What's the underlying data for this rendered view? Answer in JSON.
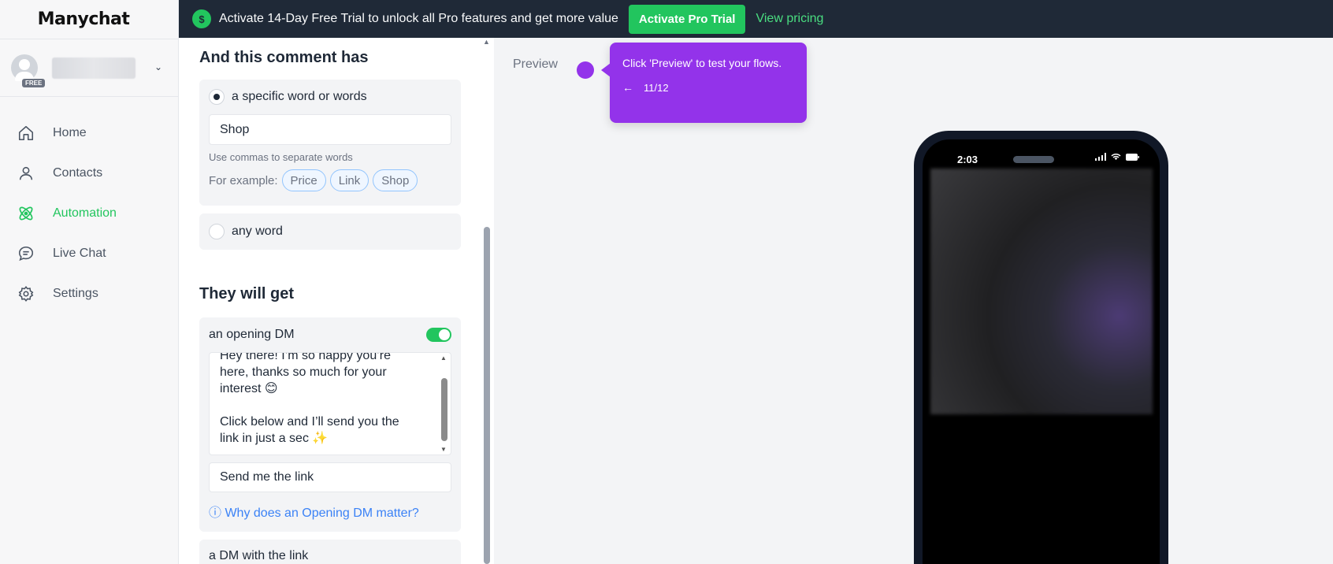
{
  "app": {
    "logo": "Manychat"
  },
  "account": {
    "badge": "FREE"
  },
  "sidebar": {
    "items": [
      {
        "label": "Home",
        "icon": "home-icon",
        "active": false
      },
      {
        "label": "Contacts",
        "icon": "user-icon",
        "active": false
      },
      {
        "label": "Automation",
        "icon": "automation-icon",
        "active": true
      },
      {
        "label": "Live Chat",
        "icon": "chat-icon",
        "active": false
      },
      {
        "label": "Settings",
        "icon": "gear-icon",
        "active": false
      }
    ]
  },
  "banner": {
    "icon": "dollar-icon",
    "text": "Activate 14-Day Free Trial to unlock all Pro features and get more value",
    "button": "Activate Pro Trial",
    "link": "View pricing"
  },
  "panel": {
    "comment_title": "And this comment has",
    "option_specific": "a specific word or words",
    "keyword_value": "Shop",
    "hint": "Use commas to separate words",
    "example_label": "For example:",
    "example_chips": [
      "Price",
      "Link",
      "Shop"
    ],
    "option_any": "any word",
    "get_title": "They will get",
    "opening_dm_label": "an opening DM",
    "opening_dm_enabled": true,
    "opening_dm_text": "Hey there! I’m so happy you’re here, thanks so much for your interest 😊\n\nClick below and I’ll send you the link in just a sec ✨",
    "button_text": "Send me the link",
    "info_link": "Why does an Opening DM matter?",
    "dm_link_label": "a DM with the link"
  },
  "preview": {
    "label": "Preview",
    "tooltip_text": "Click 'Preview' to test your flows.",
    "step": "11/12",
    "phone_time": "2:03"
  },
  "colors": {
    "accent": "#22c55e",
    "banner_bg": "#1f2937",
    "tooltip": "#9333ea",
    "link": "#3b82f6"
  }
}
